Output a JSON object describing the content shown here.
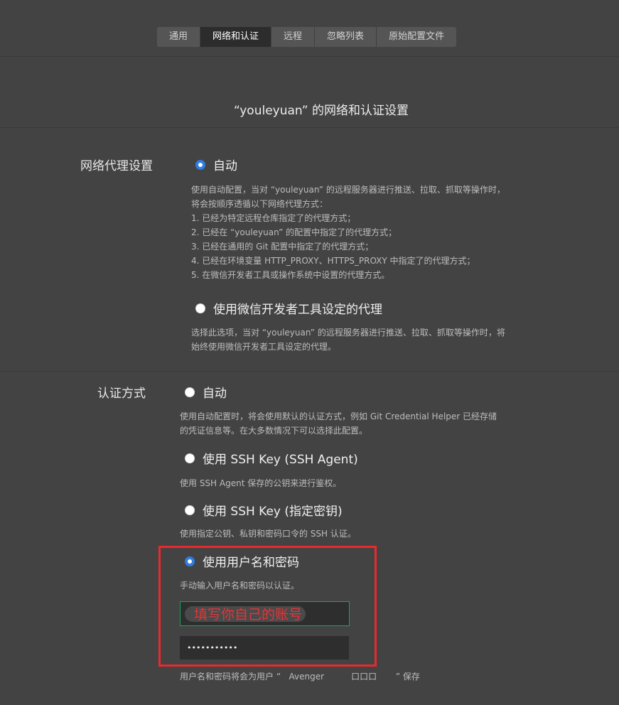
{
  "tabs": [
    {
      "label": "通用"
    },
    {
      "label": "网络和认证"
    },
    {
      "label": "远程"
    },
    {
      "label": "忽略列表"
    },
    {
      "label": "原始配置文件"
    }
  ],
  "page_title": "“youleyuan” 的网络和认证设置",
  "proxy": {
    "label": "网络代理设置",
    "option_auto": {
      "label": "自动",
      "selected": true,
      "desc": "使用自动配置，当对 “youleyuan” 的远程服务器进行推送、拉取、抓取等操作时，\n将会按顺序透循以下网络代理方式：\n1. 已经为特定远程仓库指定了的代理方式；\n2. 已经在 “youleyuan” 的配置中指定了的代理方式；\n3. 已经在通用的 Git 配置中指定了的代理方式；\n4. 已经在环境变量 HTTP_PROXY、HTTPS_PROXY 中指定了的代理方式；\n5. 在微信开发者工具或操作系统中设置的代理方式。"
    },
    "option_wechat": {
      "label": "使用微信开发者工具设定的代理",
      "selected": false,
      "desc": "选择此选项，当对 “youleyuan” 的远程服务器进行推送、拉取、抓取等操作时，将\n始终使用微信开发者工具设定的代理。"
    }
  },
  "auth": {
    "label": "认证方式",
    "options": [
      {
        "label": "自动",
        "selected": false,
        "desc": "使用自动配置时，将会使用默认的认证方式，例如 Git Credential Helper 已经存储\n的凭证信息等。在大多数情况下可以选择此配置。"
      },
      {
        "label": "使用 SSH Key (SSH Agent)",
        "selected": false,
        "desc": "使用 SSH Agent 保存的公钥来进行鉴权。"
      },
      {
        "label": "使用 SSH Key (指定密钥)",
        "selected": false,
        "desc": "使用指定公钥、私钥和密码口令的 SSH 认证。"
      },
      {
        "label": "使用用户名和密码",
        "selected": true,
        "desc": "手动输入用户名和密码以认证。"
      }
    ],
    "username_annotation": "填写你自己的账号",
    "password_value": "•••••••••••",
    "footer": "用户名和密码将会为用户 “   Avenger          口口口       ” 保存"
  },
  "colors": {
    "accent": "#2f7de1",
    "annotation_red": "#e8292d",
    "focus_green": "#1aa260"
  }
}
